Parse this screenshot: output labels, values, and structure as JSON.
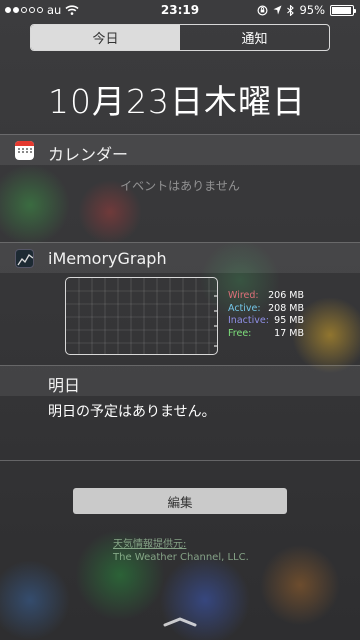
{
  "status_bar": {
    "carrier": "au",
    "time": "23:19",
    "battery": "95%",
    "battery_level": 0.95,
    "signal_filled": 2,
    "signal_total": 5
  },
  "segments": {
    "today": "今日",
    "notifications": "通知",
    "selected": "今日"
  },
  "date": "10月23日木曜日",
  "calendar": {
    "title": "カレンダー",
    "empty": "イベントはありません"
  },
  "memory_widget": {
    "title": "iMemoryGraph",
    "stats": [
      {
        "label": "Wired:",
        "value": "206 MB",
        "color": "#e0707a"
      },
      {
        "label": "Active:",
        "value": "208 MB",
        "color": "#74c7e8"
      },
      {
        "label": "Inactive:",
        "value": "95 MB",
        "color": "#8f8fe6"
      },
      {
        "label": "Free:",
        "value": "17 MB",
        "color": "#7ee07c"
      }
    ]
  },
  "tomorrow": {
    "title": "明日",
    "text": "明日の予定はありません。"
  },
  "edit_button": "編集",
  "weather_credit": {
    "label": "天気情報提供元:",
    "source": "The Weather Channel, LLC."
  }
}
